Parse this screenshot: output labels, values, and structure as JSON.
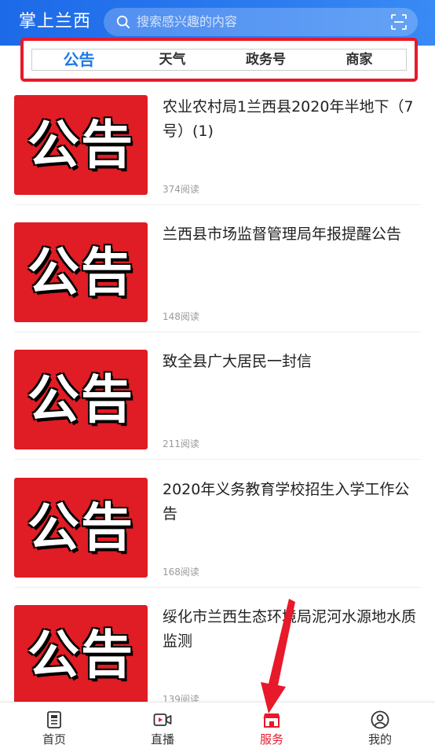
{
  "header": {
    "app_title": "掌上兰西",
    "search_placeholder": "搜索感兴趣的内容"
  },
  "tabs": [
    {
      "label": "公告",
      "active": true
    },
    {
      "label": "天气",
      "active": false
    },
    {
      "label": "政务号",
      "active": false
    },
    {
      "label": "商家",
      "active": false
    }
  ],
  "news": [
    {
      "thumb_text": "公告",
      "title": "农业农村局1兰西县2020年半地下（7号）(1)",
      "reads": "374阅读"
    },
    {
      "thumb_text": "公告",
      "title": "兰西县市场监督管理局年报提醒公告",
      "reads": "148阅读"
    },
    {
      "thumb_text": "公告",
      "title": "致全县广大居民一封信",
      "reads": "211阅读"
    },
    {
      "thumb_text": "公告",
      "title": "2020年义务教育学校招生入学工作公告",
      "reads": "168阅读"
    },
    {
      "thumb_text": "公告",
      "title": "绥化市兰西生态环境局泥河水源地水质监测",
      "reads": "139阅读"
    }
  ],
  "bottom_nav": [
    {
      "label": "首页",
      "icon": "home-doc-icon",
      "active": false
    },
    {
      "label": "直播",
      "icon": "video-icon",
      "active": false
    },
    {
      "label": "服务",
      "icon": "store-icon",
      "active": true
    },
    {
      "label": "我的",
      "icon": "profile-icon",
      "active": false
    }
  ],
  "colors": {
    "header_blue": "#2b7bf0",
    "active_tab_blue": "#1d79e6",
    "accent_red": "#e8192a",
    "thumb_red": "#e01c24"
  }
}
